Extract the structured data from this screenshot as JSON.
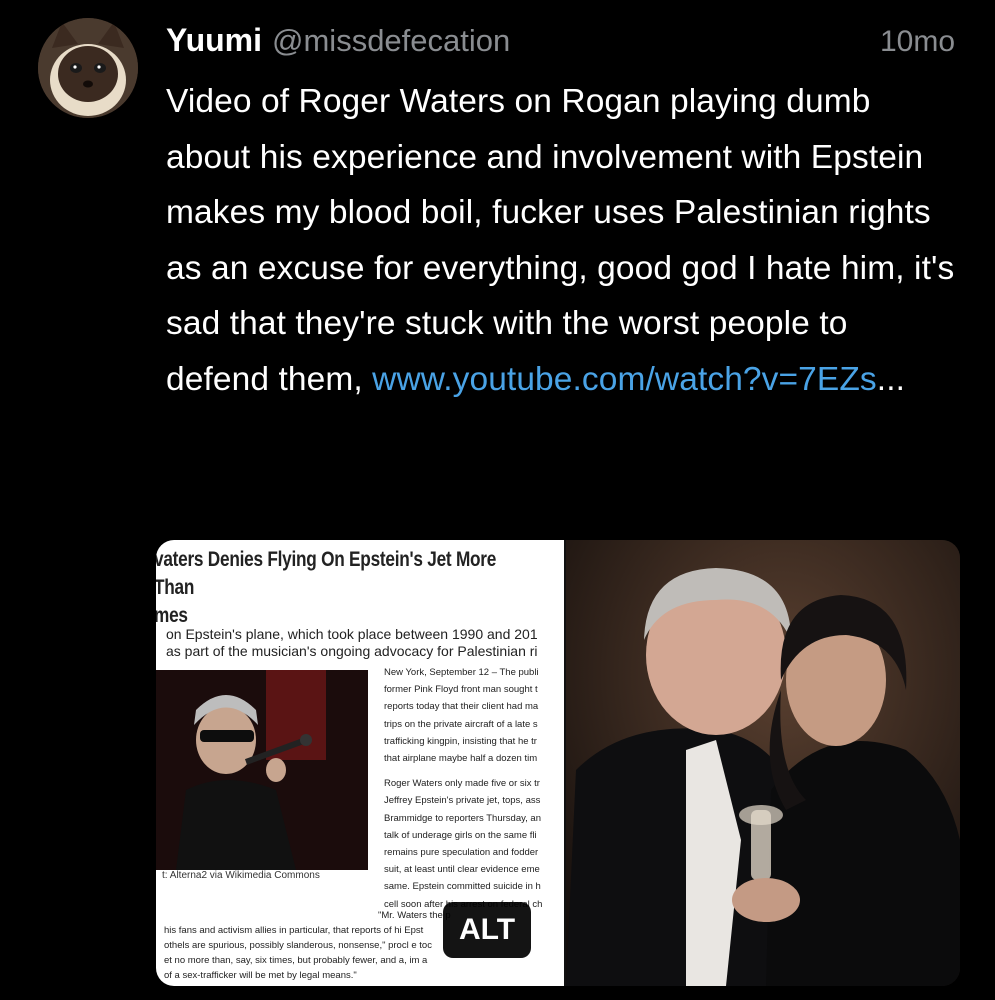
{
  "post": {
    "display_name": "Yuumi",
    "handle": "@missdefecation",
    "time": "10mo",
    "text": "Video of Roger Waters on Rogan playing dumb about his experience and involvement with Epstein makes my blood boil, fucker uses Palestinian rights as an excuse for everything, good god I hate him, it's sad that they're stuck with the worst people to defend them, ",
    "link_text": "www.youtube.com/watch?v=7EZs",
    "ellipsis": "..."
  },
  "media": {
    "alt_label": "ALT",
    "article": {
      "title_line1": "vaters Denies Flying On Epstein's Jet More Than",
      "title_line2": "mes",
      "subtitle_line1": "on Epstein's plane, which took place between 1990 and 201",
      "subtitle_line2": "as part of the musician's ongoing advocacy for Palestinian ri",
      "photo_credit": "t: Alterna2 via Wikimedia Commons",
      "column_lines": [
        "New York, September 12 – The publi",
        "former Pink Floyd front man sought t",
        "reports today that their client had ma",
        "trips on the private aircraft of a late s",
        "trafficking kingpin, insisting that he tr",
        "that airplane maybe half a dozen tim",
        "",
        "Roger Waters only made five or six tr",
        "Jeffrey Epstein's private jet, tops, ass",
        "Brammidge to reporters Thursday, an",
        "talk of underage girls on the same fli",
        "remains pure speculation and fodder",
        "suit, at least until clear evidence eme",
        "same. Epstein committed suicide in h",
        "cell soon after his arrest on federal ch"
      ],
      "bottom_lines": [
        "\"Mr. Waters                              the p",
        "his fans and activism allies in particular, that reports of hi         Epst",
        "othels are spurious, possibly slanderous, nonsense,\" procl           e toc",
        "et no more than, say, six times, but probably fewer, and a,          im a",
        "of a sex-trafficker will be met by legal means.\""
      ]
    }
  },
  "colors": {
    "background": "#000000",
    "text": "#ffffff",
    "muted": "#8a8d91",
    "link": "#4aa3e6"
  }
}
